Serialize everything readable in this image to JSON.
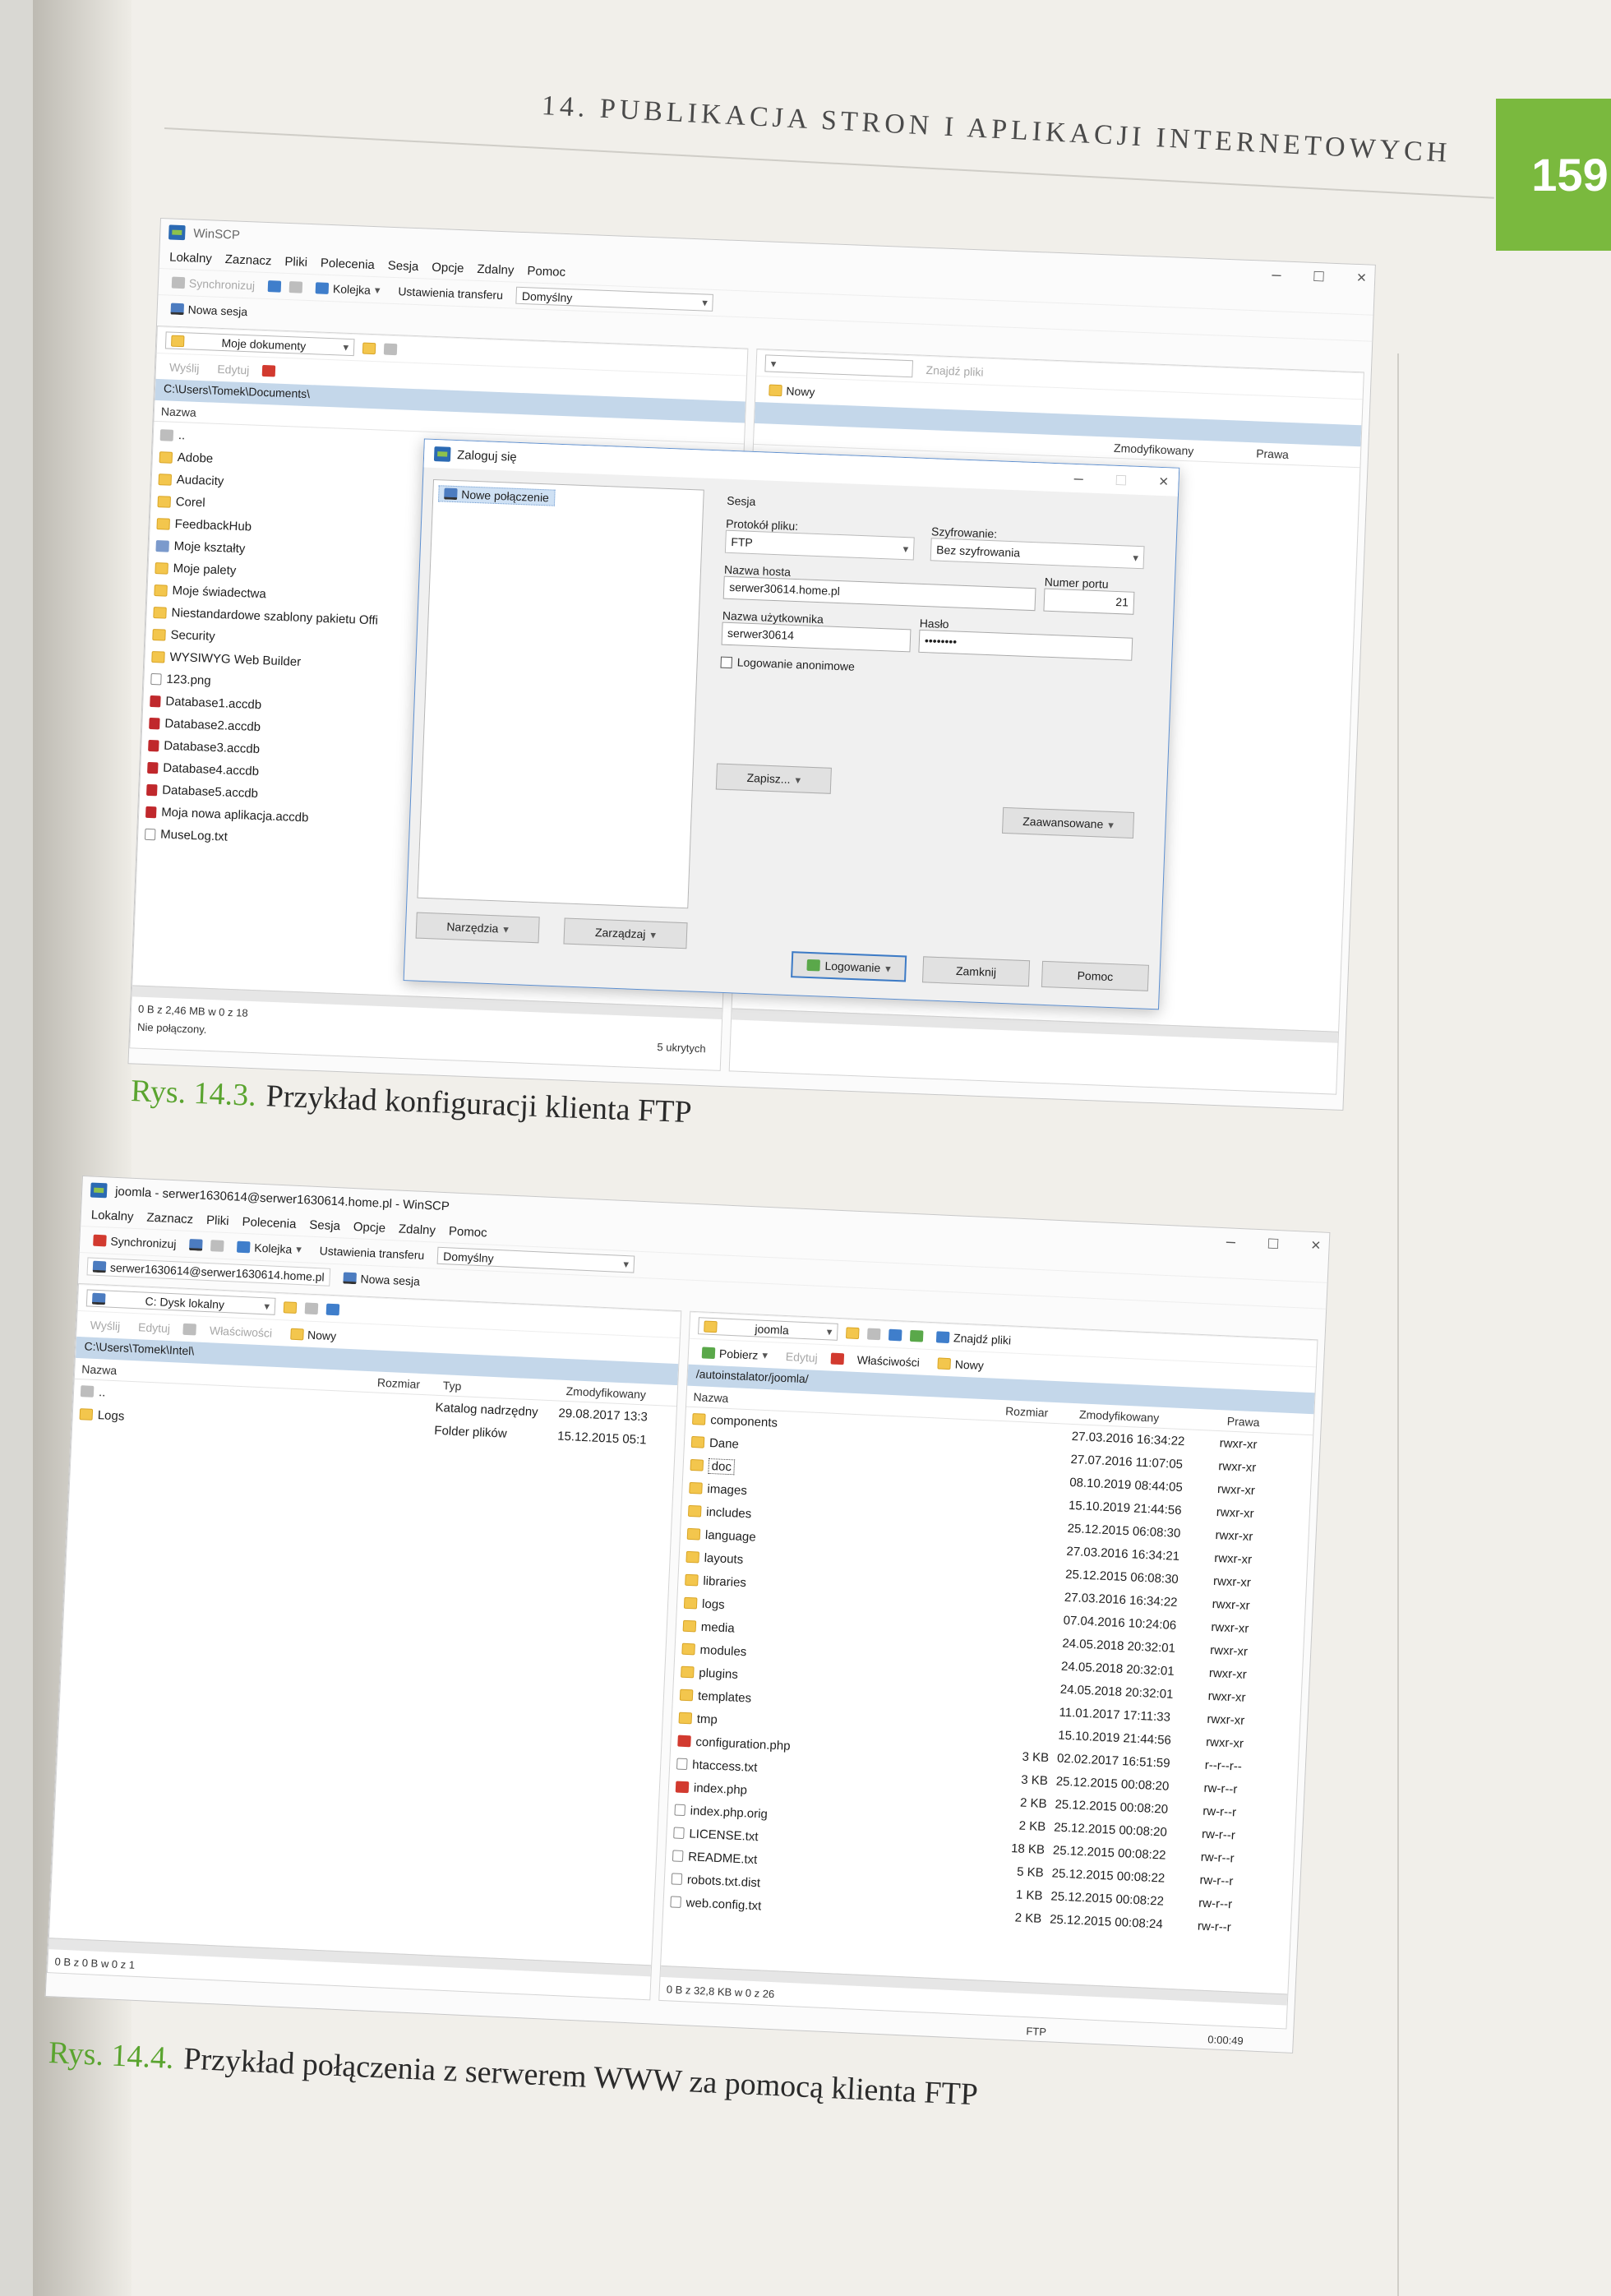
{
  "page": {
    "running_head": "14. PUBLIKACJA STRON I APLIKACJI INTERNETOWYCH",
    "page_number": "159",
    "accent_color": "#7ab93e"
  },
  "figure1": {
    "caption_num": "Rys. 14.3.",
    "caption_text": "Przykład konfiguracji klienta FTP",
    "window_title": "WinSCP",
    "menu": [
      "Lokalny",
      "Zaznacz",
      "Pliki",
      "Polecenia",
      "Sesja",
      "Opcje",
      "Zdalny",
      "Pomoc"
    ],
    "toolbar": {
      "sync": "Synchronizuj",
      "queue": "Kolejka",
      "transfer_label": "Ustawienia transferu",
      "transfer_value": "Domyślny",
      "new_session": "Nowa sesja",
      "send": "Wyślij",
      "edit": "Edytuj",
      "find": "Znajdź pliki",
      "new": "Nowy"
    },
    "left_panel": {
      "location": "Moje dokumenty",
      "path": "C:\\Users\\Tomek\\Documents\\",
      "col_name": "Nazwa",
      "items": [
        {
          "name": "..",
          "icon": "up-icon"
        },
        {
          "name": "Adobe",
          "icon": "folder-icon"
        },
        {
          "name": "Audacity",
          "icon": "folder-icon"
        },
        {
          "name": "Corel",
          "icon": "folder-icon"
        },
        {
          "name": "FeedbackHub",
          "icon": "folder-icon"
        },
        {
          "name": "Moje kształty",
          "icon": "shapes-folder-icon"
        },
        {
          "name": "Moje palety",
          "icon": "folder-icon"
        },
        {
          "name": "Moje świadectwa",
          "icon": "folder-icon"
        },
        {
          "name": "Niestandardowe szablony pakietu Offi",
          "icon": "folder-icon"
        },
        {
          "name": "Security",
          "icon": "folder-icon"
        },
        {
          "name": "WYSIWYG Web Builder",
          "icon": "folder-icon"
        },
        {
          "name": "123.png",
          "icon": "file-icon"
        },
        {
          "name": "Database1.accdb",
          "icon": "database-icon"
        },
        {
          "name": "Database2.accdb",
          "icon": "database-icon"
        },
        {
          "name": "Database3.accdb",
          "icon": "database-icon"
        },
        {
          "name": "Database4.accdb",
          "icon": "database-icon"
        },
        {
          "name": "Database5.accdb",
          "icon": "database-icon"
        },
        {
          "name": "Moja nowa aplikacja.accdb",
          "icon": "database-icon"
        },
        {
          "name": "MuseLog.txt",
          "icon": "file-icon"
        }
      ],
      "status_size": "0 B z 2,46 MB w 0 z 18",
      "status_conn": "Nie połączony.",
      "hidden": "5 ukrytych"
    },
    "right_panel": {
      "col_modified": "Zmodyfikowany",
      "col_rights": "Prawa"
    },
    "dialog": {
      "title": "Zaloguj się",
      "site_item": "Nowe połączenie",
      "section": "Sesja",
      "protocol_label": "Protokół pliku:",
      "protocol_value": "FTP",
      "encryption_label": "Szyfrowanie:",
      "encryption_value": "Bez szyfrowania",
      "host_label": "Nazwa hosta",
      "host_value": "serwer30614.home.pl",
      "port_label": "Numer portu",
      "port_value": "21",
      "user_label": "Nazwa użytkownika",
      "user_value": "serwer30614",
      "pass_label": "Hasło",
      "pass_value": "••••••••",
      "anon_label": "Logowanie anonimowe",
      "save": "Zapisz...",
      "advanced": "Zaawansowane",
      "tools": "Narzędzia",
      "manage": "Zarządzaj",
      "login": "Logowanie",
      "close": "Zamknij",
      "help": "Pomoc"
    }
  },
  "figure2": {
    "caption_num": "Rys. 14.4.",
    "caption_text": "Przykład połączenia z serwerem WWW za pomocą klienta FTP",
    "window_title": "joomla - serwer1630614@serwer1630614.home.pl - WinSCP",
    "menu": [
      "Lokalny",
      "Zaznacz",
      "Pliki",
      "Polecenia",
      "Sesja",
      "Opcje",
      "Zdalny",
      "Pomoc"
    ],
    "toolbar": {
      "sync": "Synchronizuj",
      "queue": "Kolejka",
      "transfer_label": "Ustawienia transferu",
      "transfer_value": "Domyślny",
      "session_tab": "serwer1630614@serwer1630614.home.pl",
      "new_session": "Nowa sesja",
      "send": "Wyślij",
      "edit": "Edytuj",
      "props": "Właściwości",
      "new": "Nowy",
      "download": "Pobierz",
      "find": "Znajdź pliki"
    },
    "left_panel": {
      "location": "C: Dysk lokalny",
      "path": "C:\\Users\\Tomek\\Intel\\",
      "col_name": "Nazwa",
      "col_size": "Rozmiar",
      "col_type": "Typ",
      "col_modified": "Zmodyfikowany",
      "rows": [
        {
          "name": "..",
          "type": "Katalog nadrzędny",
          "modified": "29.08.2017 13:3"
        },
        {
          "name": "Logs",
          "type": "Folder plików",
          "modified": "15.12.2015 05:1"
        }
      ],
      "status": "0 B z 0 B w 0 z 1"
    },
    "right_panel": {
      "location": "joomla",
      "path": "/autoinstalator/joomla/",
      "col_name": "Nazwa",
      "col_size": "Rozmiar",
      "col_modified": "Zmodyfikowany",
      "col_rights": "Prawa",
      "rows": [
        {
          "name": "components",
          "size": "",
          "modified": "27.03.2016 16:34:22",
          "rights": "rwxr-xr",
          "icon": "folder-icon"
        },
        {
          "name": "Dane",
          "size": "",
          "modified": "27.07.2016 11:07:05",
          "rights": "rwxr-xr",
          "icon": "folder-icon"
        },
        {
          "name": "doc",
          "size": "",
          "modified": "08.10.2019 08:44:05",
          "rights": "rwxr-xr",
          "icon": "folder-icon"
        },
        {
          "name": "images",
          "size": "",
          "modified": "15.10.2019 21:44:56",
          "rights": "rwxr-xr",
          "icon": "folder-icon"
        },
        {
          "name": "includes",
          "size": "",
          "modified": "25.12.2015 06:08:30",
          "rights": "rwxr-xr",
          "icon": "folder-icon"
        },
        {
          "name": "language",
          "size": "",
          "modified": "27.03.2016 16:34:21",
          "rights": "rwxr-xr",
          "icon": "folder-icon"
        },
        {
          "name": "layouts",
          "size": "",
          "modified": "25.12.2015 06:08:30",
          "rights": "rwxr-xr",
          "icon": "folder-icon"
        },
        {
          "name": "libraries",
          "size": "",
          "modified": "27.03.2016 16:34:22",
          "rights": "rwxr-xr",
          "icon": "folder-icon"
        },
        {
          "name": "logs",
          "size": "",
          "modified": "07.04.2016 10:24:06",
          "rights": "rwxr-xr",
          "icon": "folder-icon"
        },
        {
          "name": "media",
          "size": "",
          "modified": "24.05.2018 20:32:01",
          "rights": "rwxr-xr",
          "icon": "folder-icon"
        },
        {
          "name": "modules",
          "size": "",
          "modified": "24.05.2018 20:32:01",
          "rights": "rwxr-xr",
          "icon": "folder-icon"
        },
        {
          "name": "plugins",
          "size": "",
          "modified": "24.05.2018 20:32:01",
          "rights": "rwxr-xr",
          "icon": "folder-icon"
        },
        {
          "name": "templates",
          "size": "",
          "modified": "11.01.2017 17:11:33",
          "rights": "rwxr-xr",
          "icon": "folder-icon"
        },
        {
          "name": "tmp",
          "size": "",
          "modified": "15.10.2019 21:44:56",
          "rights": "rwxr-xr",
          "icon": "folder-icon"
        },
        {
          "name": "configuration.php",
          "size": "3 KB",
          "modified": "02.02.2017 16:51:59",
          "rights": "r--r--r--",
          "icon": "php-file-icon"
        },
        {
          "name": "htaccess.txt",
          "size": "3 KB",
          "modified": "25.12.2015 00:08:20",
          "rights": "rw-r--r",
          "icon": "file-icon"
        },
        {
          "name": "index.php",
          "size": "2 KB",
          "modified": "25.12.2015 00:08:20",
          "rights": "rw-r--r",
          "icon": "php-file-icon"
        },
        {
          "name": "index.php.orig",
          "size": "2 KB",
          "modified": "25.12.2015 00:08:20",
          "rights": "rw-r--r",
          "icon": "file-icon"
        },
        {
          "name": "LICENSE.txt",
          "size": "18 KB",
          "modified": "25.12.2015 00:08:22",
          "rights": "rw-r--r",
          "icon": "file-icon"
        },
        {
          "name": "README.txt",
          "size": "5 KB",
          "modified": "25.12.2015 00:08:22",
          "rights": "rw-r--r",
          "icon": "file-icon"
        },
        {
          "name": "robots.txt.dist",
          "size": "1 KB",
          "modified": "25.12.2015 00:08:22",
          "rights": "rw-r--r",
          "icon": "file-icon"
        },
        {
          "name": "web.config.txt",
          "size": "2 KB",
          "modified": "25.12.2015 00:08:24",
          "rights": "rw-r--r",
          "icon": "file-icon"
        }
      ],
      "status": "0 B z 32,8 KB w 0 z 26",
      "protocol": "FTP",
      "timer": "0:00:49"
    }
  }
}
